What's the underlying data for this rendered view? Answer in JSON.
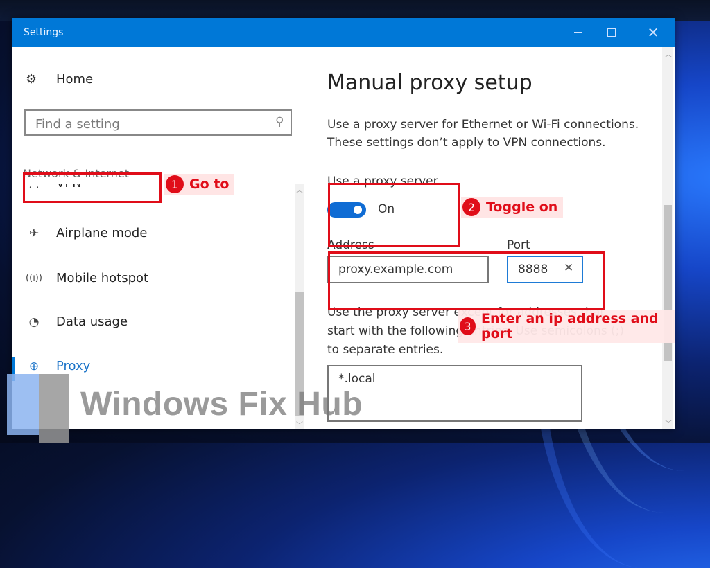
{
  "window": {
    "title": "Settings",
    "controls": {
      "minimize": "minimize",
      "maximize": "maximize",
      "close": "close"
    }
  },
  "sidebar": {
    "home_label": "Home",
    "search_placeholder": "Find a setting",
    "section_header": "Network & Internet",
    "items": [
      {
        "label": "VPN",
        "icon": "vpn-icon",
        "glyph": "⸬"
      },
      {
        "label": "Airplane mode",
        "icon": "airplane-icon",
        "glyph": "✈"
      },
      {
        "label": "Mobile hotspot",
        "icon": "hotspot-icon",
        "glyph": "((ı))"
      },
      {
        "label": "Data usage",
        "icon": "data-usage-icon",
        "glyph": "◔"
      },
      {
        "label": "Proxy",
        "icon": "globe-icon",
        "glyph": "⊕",
        "active": true
      }
    ]
  },
  "main": {
    "title": "Manual proxy setup",
    "description": "Use a proxy server for Ethernet or Wi-Fi connections. These settings don’t apply to VPN connections.",
    "use_proxy_label": "Use a proxy server",
    "use_proxy_state": "On",
    "use_proxy_enabled": true,
    "address_label": "Address",
    "address_value": "proxy.example.com",
    "port_label": "Port",
    "port_value": "8888",
    "exceptions_description": "Use the proxy server except for addresses that start with the following entries. Use semicolons (;) to separate entries.",
    "exceptions_value": "*.local"
  },
  "annotations": [
    {
      "number": "1",
      "text": "Go to"
    },
    {
      "number": "2",
      "text": "Toggle on"
    },
    {
      "number": "3",
      "text": "Enter an ip address and port"
    }
  ],
  "watermark": "Windows Fix Hub",
  "colors": {
    "accent": "#0078d7",
    "annotation_red": "#e00d19",
    "toggle_on": "#0f6cd4"
  }
}
